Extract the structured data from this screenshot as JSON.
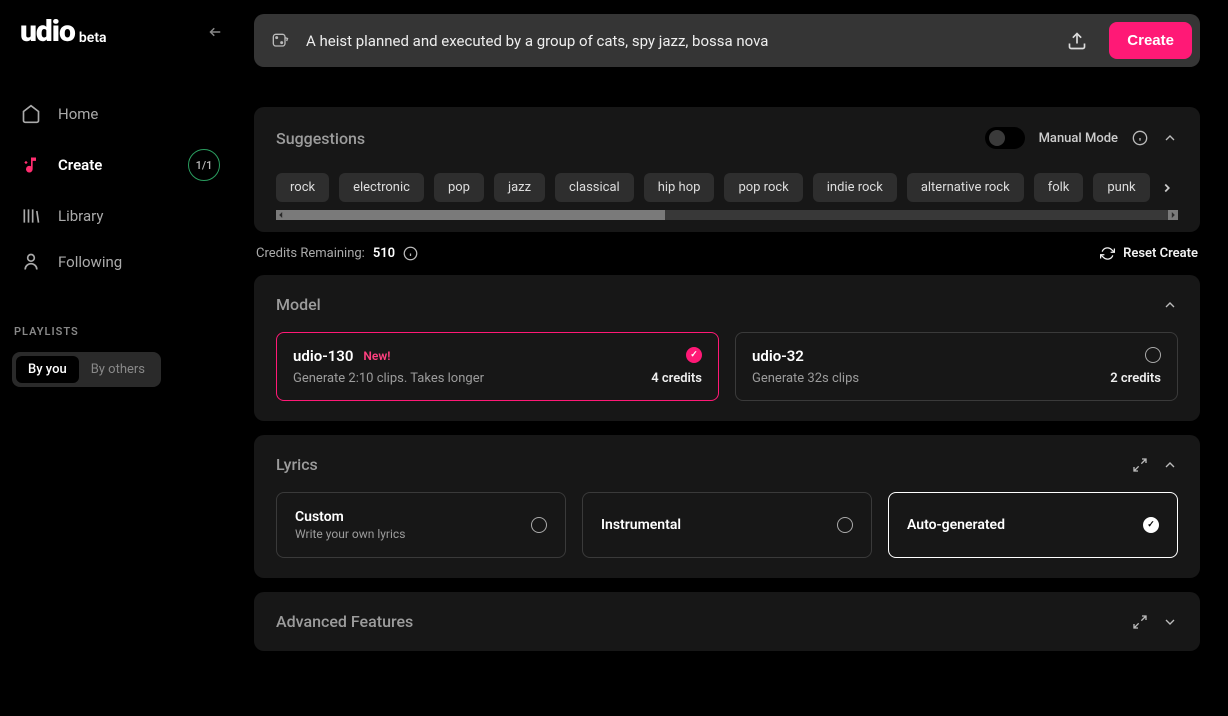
{
  "brand": {
    "name": "udio",
    "tag": "beta"
  },
  "sidebar": {
    "items": [
      {
        "label": "Home"
      },
      {
        "label": "Create",
        "badge": "1/1"
      },
      {
        "label": "Library"
      },
      {
        "label": "Following"
      }
    ],
    "playlists_heading": "PLAYLISTS",
    "playlist_tabs": [
      {
        "label": "By you"
      },
      {
        "label": "By others"
      }
    ]
  },
  "prompt": {
    "text": "A heist planned and executed by a group of cats, spy jazz, bossa nova",
    "create_label": "Create"
  },
  "suggestions": {
    "title": "Suggestions",
    "manual_mode_label": "Manual Mode",
    "chips": [
      "rock",
      "electronic",
      "pop",
      "jazz",
      "classical",
      "hip hop",
      "pop rock",
      "indie rock",
      "alternative rock",
      "folk",
      "punk"
    ]
  },
  "credits": {
    "label": "Credits Remaining:",
    "value": "510",
    "reset_label": "Reset Create"
  },
  "model": {
    "title": "Model",
    "options": [
      {
        "name": "udio-130",
        "new_label": "New!",
        "desc": "Generate 2:10 clips. Takes longer",
        "credits": "4 credits",
        "selected": true
      },
      {
        "name": "udio-32",
        "desc": "Generate 32s clips",
        "credits": "2 credits",
        "selected": false
      }
    ]
  },
  "lyrics": {
    "title": "Lyrics",
    "options": [
      {
        "name": "Custom",
        "desc": "Write your own lyrics",
        "selected": false
      },
      {
        "name": "Instrumental",
        "selected": false
      },
      {
        "name": "Auto-generated",
        "selected": true
      }
    ]
  },
  "advanced": {
    "title": "Advanced Features"
  }
}
